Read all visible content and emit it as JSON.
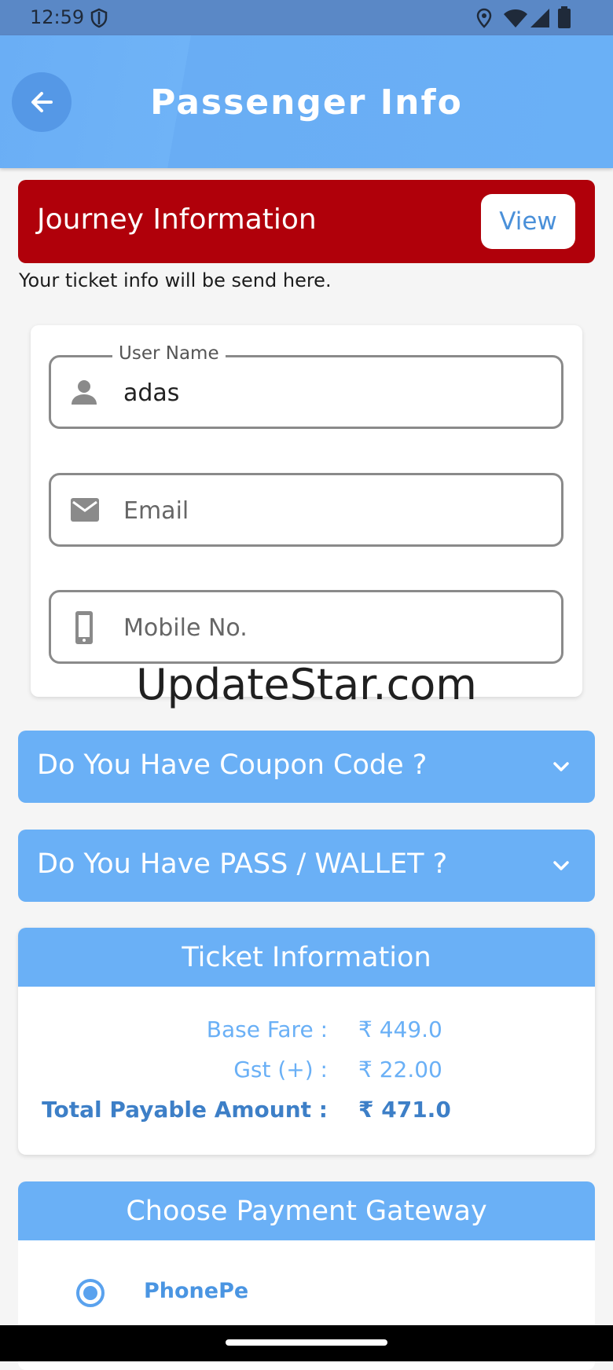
{
  "status_bar": {
    "time": "12:59",
    "icons": [
      "shield-icon",
      "location-icon",
      "wifi-icon",
      "signal-icon",
      "battery-icon"
    ]
  },
  "app_bar": {
    "title": "Passenger Info",
    "back_icon": "arrow-left-icon"
  },
  "journey": {
    "label": "Journey Information",
    "view_label": "View",
    "note": "Your ticket info will be send here."
  },
  "form": {
    "username": {
      "label": "User Name",
      "value": "adas",
      "icon": "person-icon"
    },
    "email": {
      "placeholder": "Email",
      "value": "",
      "icon": "mail-icon"
    },
    "mobile": {
      "placeholder": "Mobile No.",
      "value": "",
      "icon": "phone-icon"
    }
  },
  "watermark": "UpdateStar.com",
  "coupon": {
    "label": "Do You Have Coupon Code ?",
    "icon": "chevron-down-icon"
  },
  "pass_wallet": {
    "label": "Do You Have PASS / WALLET ?",
    "icon": "chevron-down-icon"
  },
  "ticket_info": {
    "title": "Ticket Information",
    "rows": [
      {
        "label": "Base Fare :",
        "value": "₹ 449.0"
      },
      {
        "label": "Gst (+) :",
        "value": "₹ 22.00"
      },
      {
        "label": "Total Payable Amount :",
        "value": "₹ 471.0"
      }
    ]
  },
  "payment": {
    "title": "Choose Payment Gateway",
    "options": [
      {
        "label": "PhonePe",
        "selected": true
      }
    ]
  },
  "colors": {
    "primary": "#6ab0f6",
    "banner_red": "#b0000a",
    "accent_dark": "#3d7fc7"
  }
}
